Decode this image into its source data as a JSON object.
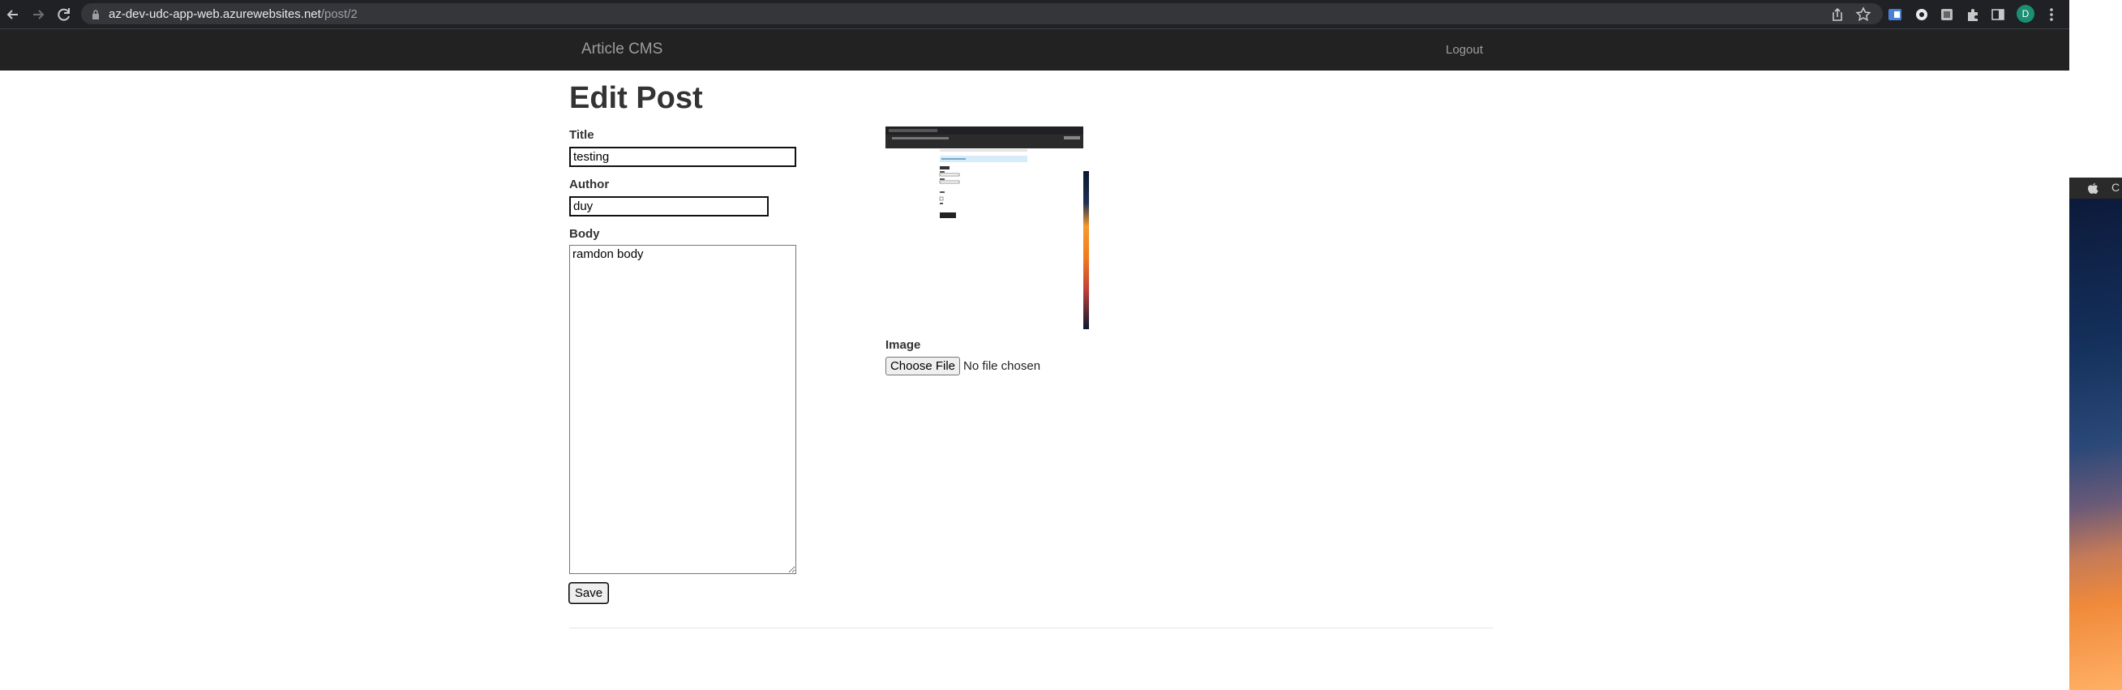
{
  "browser": {
    "url_host": "az-dev-udc-app-web.azurewebsites.net",
    "url_path": "/post/2",
    "profile_initial": "D"
  },
  "navbar": {
    "brand": "Article CMS",
    "logout_label": "Logout"
  },
  "form": {
    "heading": "Edit Post",
    "title_label": "Title",
    "title_value": "testing",
    "author_label": "Author",
    "author_value": "duy",
    "body_label": "Body",
    "body_value": "ramdon body",
    "save_label": "Save"
  },
  "image": {
    "label": "Image",
    "choose_label": "Choose File",
    "status": "No file chosen"
  },
  "desktop": {
    "menu_text": "C"
  },
  "colors": {
    "chrome_bg": "#202124",
    "navbar_bg": "#222222",
    "navbar_text": "#9d9d9d",
    "profile_bg": "#1a8f73"
  }
}
